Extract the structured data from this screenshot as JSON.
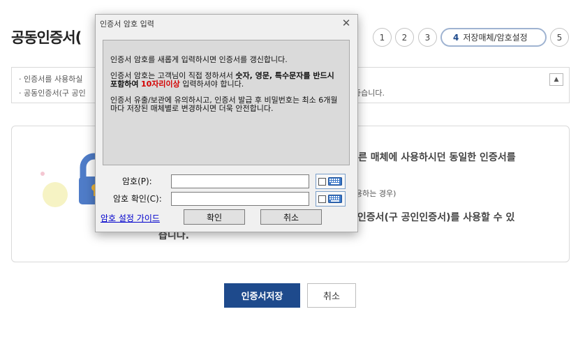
{
  "page": {
    "title": "공동인증서(",
    "steps": [
      "1",
      "2",
      "3",
      "5"
    ],
    "active_step": {
      "num": "4",
      "label": "저장매체/암호설정"
    },
    "notice": {
      "line1": "· 인증서를 사용하실",
      "line2": "· 공동인증서(구 공인",
      "line2_tail": "좋습니다."
    },
    "info": {
      "text1": "른 매체에 사용하시던 동일한 인증서를",
      "text1b": "",
      "text2": "용하는 경우)",
      "text3": "동인증서(구 공인인증서)를 사용할 수 있",
      "text3b": "습니다."
    },
    "buttons": {
      "save": "인증서저장",
      "cancel": "취소"
    }
  },
  "dialog": {
    "title": "인증서 암호 입력",
    "close": "✕",
    "msg1": "인증서 암호를 새롭게 입력하시면 인증서를 갱신합니다.",
    "msg2_a": "인증서 암호는 고객님이 직접 정하셔서 ",
    "msg2_b": "숫자, 영문, 특수문자를 반드시 포함하여",
    "msg2_c": "10자리이상",
    "msg2_d": " 입력하셔야 합니다.",
    "msg3": "인증서 유출/보관에 유의하시고, 인증서 발급 후 비밀번호는 최소 6개월 마다 저장된 매체별로 변경하시면 더욱 안전합니다.",
    "pw_label": "암호(P):",
    "pw_confirm_label": "암호 확인(C):",
    "pw_value": "",
    "pw_confirm_value": "",
    "guide_link": "암호 설정 가이드",
    "ok": "확인",
    "cancel": "취소"
  },
  "colors": {
    "primary": "#1e4a8c",
    "warning_red": "#d40000",
    "link": "#0000cc"
  }
}
